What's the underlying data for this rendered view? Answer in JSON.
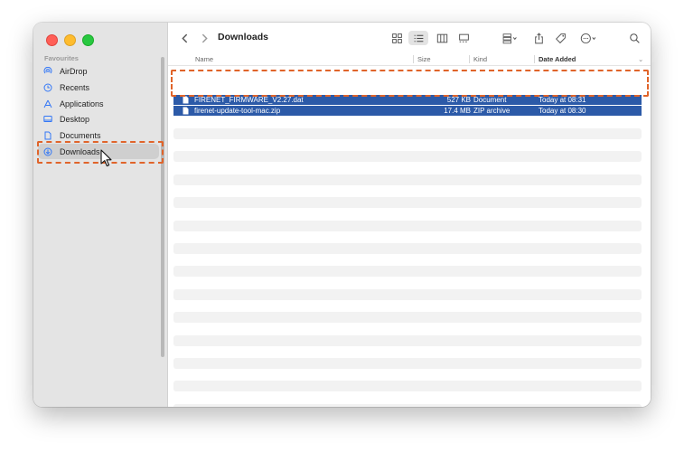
{
  "window": {
    "title": "Downloads"
  },
  "sidebar": {
    "section": "Favourites",
    "items": [
      {
        "label": "AirDrop",
        "icon": "airdrop-icon"
      },
      {
        "label": "Recents",
        "icon": "clock-icon"
      },
      {
        "label": "Applications",
        "icon": "applications-icon"
      },
      {
        "label": "Desktop",
        "icon": "desktop-icon"
      },
      {
        "label": "Documents",
        "icon": "document-icon"
      },
      {
        "label": "Downloads",
        "icon": "download-icon",
        "selected": true
      }
    ]
  },
  "list": {
    "columns": {
      "name": "Name",
      "size": "Size",
      "kind": "Kind",
      "date": "Date Added"
    },
    "rows": [
      {
        "name": "FIRENET_FIRMWARE_V2.27.dat",
        "size": "527 KB",
        "kind": "Document",
        "date": "Today at 08:31"
      },
      {
        "name": "firenet-update-tool-mac.zip",
        "size": "17.4 MB",
        "kind": "ZIP archive",
        "date": "Today at 08:30"
      }
    ]
  },
  "colors": {
    "selection": "#2c5aa8",
    "highlight": "#e0642a",
    "accent": "#3478f6"
  }
}
